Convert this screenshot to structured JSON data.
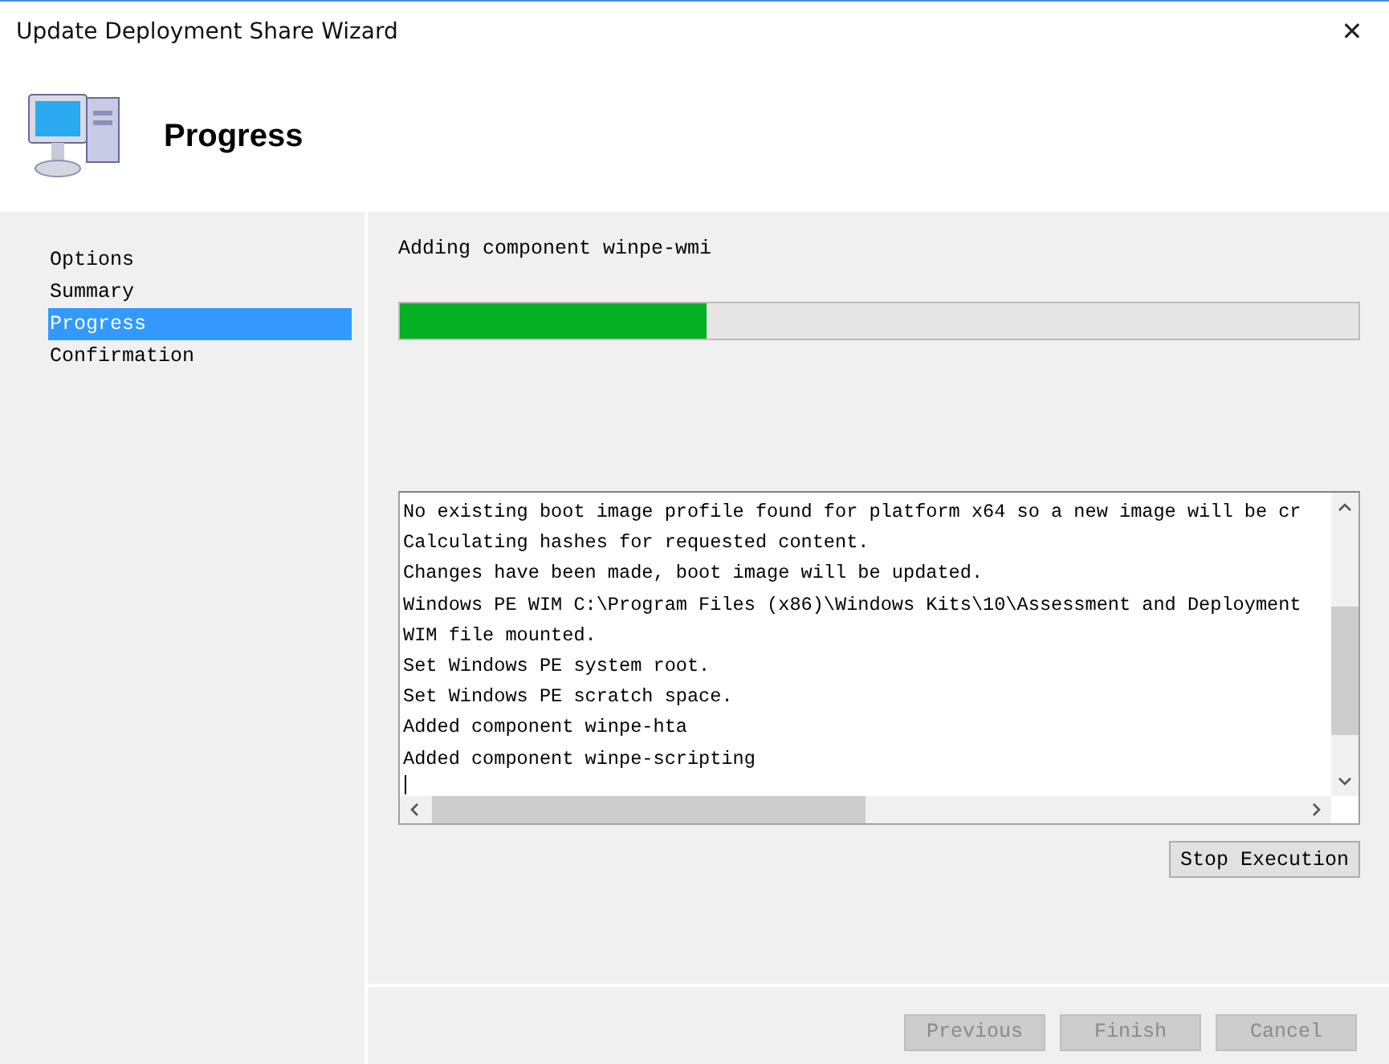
{
  "window": {
    "title": "Update Deployment Share Wizard",
    "close": "✕"
  },
  "header": {
    "title": "Progress"
  },
  "sidebar": {
    "items": [
      {
        "label": "Options",
        "selected": false
      },
      {
        "label": "Summary",
        "selected": false
      },
      {
        "label": "Progress",
        "selected": true
      },
      {
        "label": "Confirmation",
        "selected": false
      }
    ]
  },
  "status": "Adding component winpe-wmi",
  "progress": {
    "level": 0.32
  },
  "log": [
    "No existing boot image profile found for platform x64 so a new image will be cr",
    "Calculating hashes for requested content.",
    "Changes have been made, boot image will be updated.",
    "Windows PE WIM C:\\Program Files (x86)\\Windows Kits\\10\\Assessment and Deployment",
    "WIM file mounted.",
    "Set Windows PE system root.",
    "Set Windows PE scratch space.",
    "Added component winpe-hta",
    "Added component winpe-scripting"
  ],
  "stop_button": {
    "label": "Stop Execution",
    "disabled": false
  },
  "buttons": [
    {
      "label": "Previous",
      "disabled": true
    },
    {
      "label": "Finish",
      "disabled": true
    },
    {
      "label": "Cancel",
      "disabled": true
    }
  ]
}
